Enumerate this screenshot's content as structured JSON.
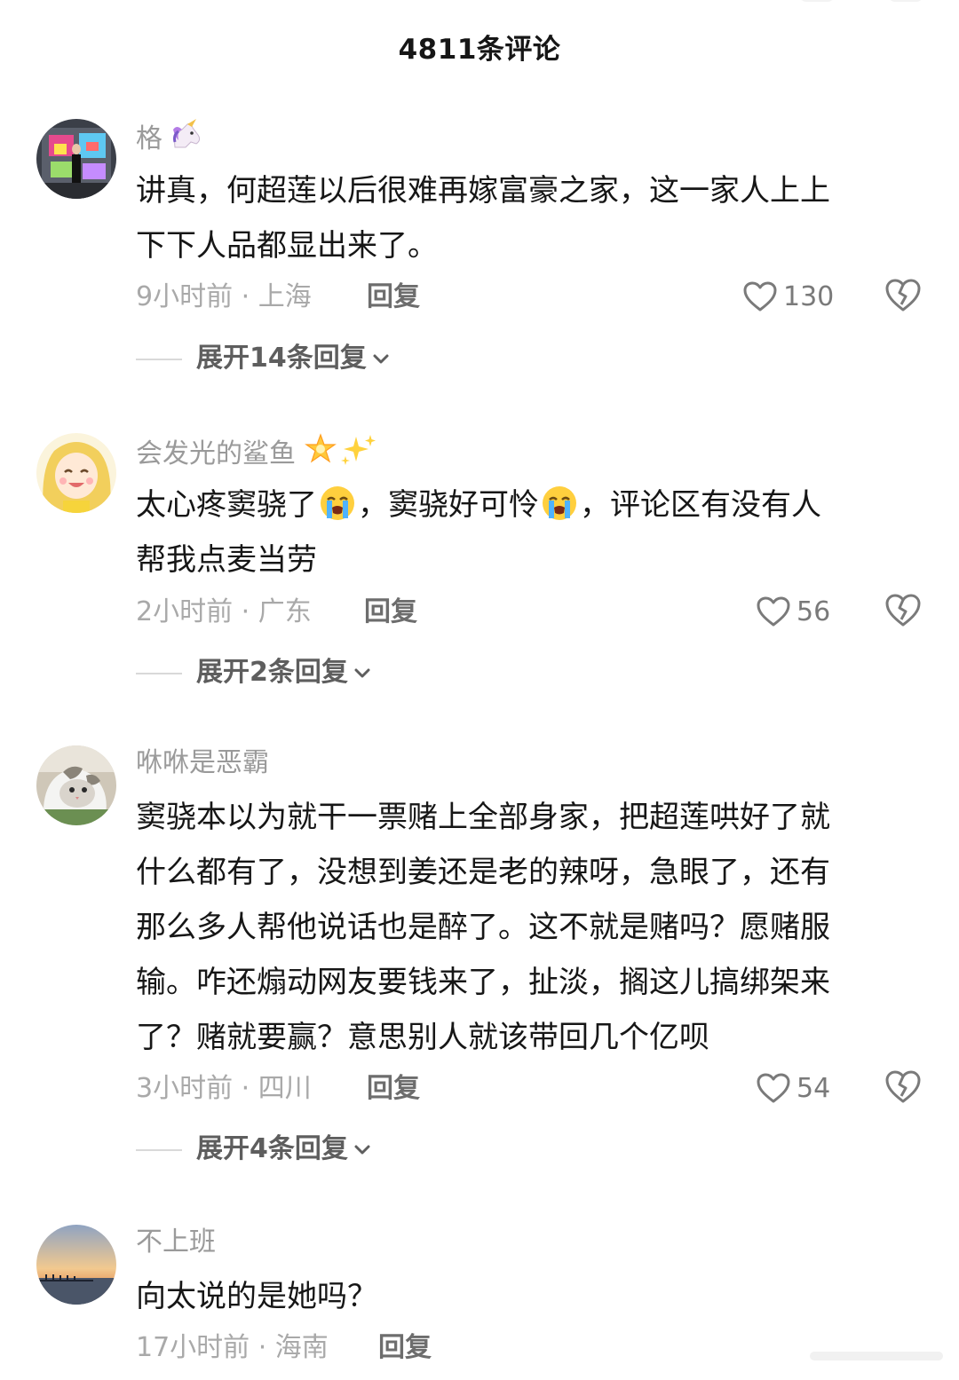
{
  "header": {
    "title": "4811条评论"
  },
  "comments": [
    {
      "username": "格",
      "username_emoji": "unicorn-emoji",
      "lines": [
        "讲真，何超莲以后很难再嫁富豪之家，这一家人上上",
        "下下人品都显出来了。"
      ],
      "time_location": "9小时前 · 上海",
      "reply_label": "回复",
      "likes": "130",
      "expand_label": "展开14条回复"
    },
    {
      "username": "会发光的鲨鱼",
      "username_emoji": "glowing-star-sparkles-emoji",
      "lines": [
        "太心疼窦骁了",
        "，窦骁好可怜",
        "，评论区有没有人",
        "帮我点麦当劳"
      ],
      "time_location": "2小时前 · 广东",
      "reply_label": "回复",
      "likes": "56",
      "expand_label": "展开2条回复"
    },
    {
      "username": "咻咻是恶霸",
      "lines": [
        "窦骁本以为就干一票赌上全部身家，把超莲哄好了就",
        "什么都有了，没想到姜还是老的辣呀，急眼了，还有",
        "那么多人帮他说话也是醉了。这不就是赌吗？愿赌服",
        "输。咋还煽动网友要钱来了，扯淡，搁这儿搞绑架来",
        "了？赌就要赢？意思别人就该带回几个亿呗"
      ],
      "time_location": "3小时前 · 四川",
      "reply_label": "回复",
      "likes": "54",
      "expand_label": "展开4条回复"
    },
    {
      "username": "不上班",
      "lines": [
        "向太说的是她吗？"
      ],
      "time_location": "17小时前 · 海南",
      "reply_label": "回复"
    }
  ],
  "icons": {
    "like": "heart-outline-icon",
    "dislike": "broken-heart-icon",
    "expand": "chevron-down-icon",
    "crying_emoji": "loudly-crying-face-emoji"
  },
  "colors": {
    "text": "#161616",
    "username": "#9a9a9a",
    "meta": "#a9a9a9",
    "reply": "#6d6d6d"
  }
}
